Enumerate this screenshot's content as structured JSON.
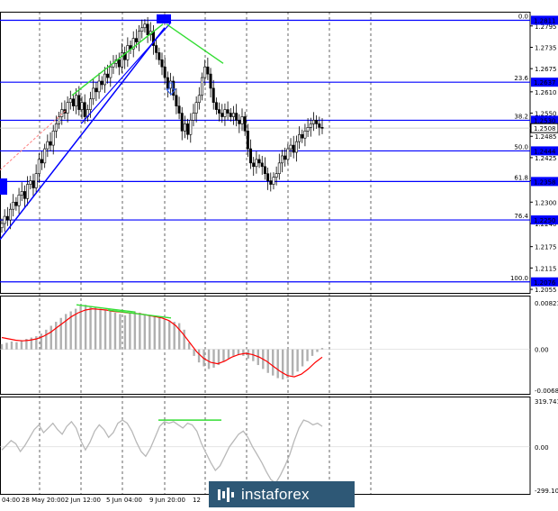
{
  "chart_data": [
    {
      "type": "candlestick",
      "panel": "price",
      "ylim": [
        1.2045,
        1.2835
      ],
      "y_ticks": [
        1.2795,
        1.2735,
        1.2675,
        1.261,
        1.255,
        1.2485,
        1.2425,
        1.236,
        1.23,
        1.224,
        1.2175,
        1.2115,
        1.2055
      ],
      "x_tick_labels": [
        "04:00",
        "28 May 20:00",
        "2 Jun 12:00",
        "5 Jun 04:00",
        "9 Jun 20:00",
        "12"
      ],
      "fib_levels": [
        {
          "label": "0.0",
          "price": 1.2811
        },
        {
          "label": "23.6",
          "price": 1.2637
        },
        {
          "label": "38.2",
          "price": 1.253
        },
        {
          "label": "50.0",
          "price": 1.2444
        },
        {
          "label": "61.8",
          "price": 1.2358
        },
        {
          "label": "76.4",
          "price": 1.225
        },
        {
          "label": "100.0",
          "price": 1.2076
        }
      ],
      "current_price": 1.2508,
      "closes": [
        1.224,
        1.226,
        1.225,
        1.228,
        1.23,
        1.229,
        1.232,
        1.233,
        1.231,
        1.235,
        1.236,
        1.234,
        1.238,
        1.242,
        1.241,
        1.245,
        1.247,
        1.246,
        1.25,
        1.252,
        1.254,
        1.256,
        1.255,
        1.258,
        1.259,
        1.257,
        1.26,
        1.256,
        1.258,
        1.254,
        1.256,
        1.259,
        1.262,
        1.261,
        1.264,
        1.263,
        1.266,
        1.265,
        1.268,
        1.269,
        1.27,
        1.268,
        1.272,
        1.27,
        1.274,
        1.273,
        1.276,
        1.275,
        1.278,
        1.279,
        1.28,
        1.277,
        1.278,
        1.274,
        1.272,
        1.27,
        1.268,
        1.265,
        1.262,
        1.264,
        1.26,
        1.257,
        1.255,
        1.25,
        1.252,
        1.249,
        1.253,
        1.255,
        1.258,
        1.26,
        1.265,
        1.268,
        1.266,
        1.262,
        1.258,
        1.256,
        1.255,
        1.254,
        1.256,
        1.255,
        1.254,
        1.255,
        1.253,
        1.252,
        1.254,
        1.25,
        1.245,
        1.241,
        1.24,
        1.242,
        1.241,
        1.24,
        1.238,
        1.236,
        1.235,
        1.237,
        1.238,
        1.241,
        1.243,
        1.242,
        1.245,
        1.246,
        1.244,
        1.247,
        1.249,
        1.248,
        1.25,
        1.251,
        1.252,
        1.253,
        1.252,
        1.251,
        1.2508
      ]
    },
    {
      "type": "bar+line",
      "panel": "macd",
      "ylim": [
        -0.0068,
        0.00821
      ],
      "y_tick_labels": [
        "0.00821",
        "0.00",
        "-0.0068"
      ],
      "histogram": [
        0.0008,
        0.001,
        0.0012,
        0.0011,
        0.0014,
        0.0016,
        0.0018,
        0.002,
        0.0024,
        0.003,
        0.0036,
        0.0042,
        0.0048,
        0.0054,
        0.0058,
        0.0062,
        0.0066,
        0.0068,
        0.0066,
        0.0064,
        0.0062,
        0.006,
        0.0058,
        0.0056,
        0.0054,
        0.0052,
        0.0055,
        0.0058,
        0.0056,
        0.0054,
        0.0052,
        0.005,
        0.0048,
        0.0046,
        0.0044,
        0.0042,
        0.004,
        0.003,
        0.001,
        -0.001,
        -0.002,
        -0.0026,
        -0.003,
        -0.0028,
        -0.0024,
        -0.0018,
        -0.0014,
        -0.001,
        -0.0008,
        -0.001,
        -0.0014,
        -0.0018,
        -0.0024,
        -0.003,
        -0.0036,
        -0.004,
        -0.0044,
        -0.0046,
        -0.0044,
        -0.004,
        -0.0034,
        -0.0026,
        -0.0018,
        -0.001,
        -0.0004,
        0.0002
      ],
      "signal": [
        0.0018,
        0.0016,
        0.0014,
        0.0013,
        0.0014,
        0.0016,
        0.002,
        0.0026,
        0.0034,
        0.0042,
        0.005,
        0.0056,
        0.006,
        0.0062,
        0.0061,
        0.006,
        0.0058,
        0.0057,
        0.0056,
        0.0055,
        0.0054,
        0.0052,
        0.005,
        0.0048,
        0.0044,
        0.0036,
        0.0024,
        0.001,
        -0.0004,
        -0.0014,
        -0.002,
        -0.0022,
        -0.0018,
        -0.0012,
        -0.0008,
        -0.0006,
        -0.0008,
        -0.0012,
        -0.0018,
        -0.0026,
        -0.0034,
        -0.004,
        -0.0042,
        -0.0038,
        -0.003,
        -0.002,
        -0.0012
      ]
    },
    {
      "type": "line",
      "panel": "cci",
      "ylim": [
        -299.108,
        319.7413
      ],
      "y_tick_labels": [
        "319.7413",
        "0.00",
        "-299.108"
      ],
      "values": [
        -20,
        10,
        40,
        20,
        -30,
        10,
        60,
        110,
        140,
        90,
        120,
        150,
        110,
        80,
        130,
        160,
        120,
        40,
        -20,
        30,
        100,
        140,
        110,
        60,
        90,
        150,
        170,
        150,
        100,
        30,
        -30,
        -60,
        -10,
        60,
        130,
        160,
        150,
        160,
        140,
        120,
        150,
        140,
        100,
        20,
        -40,
        -100,
        -150,
        -120,
        -60,
        0,
        40,
        80,
        100,
        60,
        0,
        -50,
        -100,
        -160,
        -210,
        -230,
        -180,
        -120,
        -50,
        40,
        120,
        170,
        160,
        140,
        150,
        130
      ]
    }
  ],
  "watermark": {
    "text": "instaforex"
  }
}
